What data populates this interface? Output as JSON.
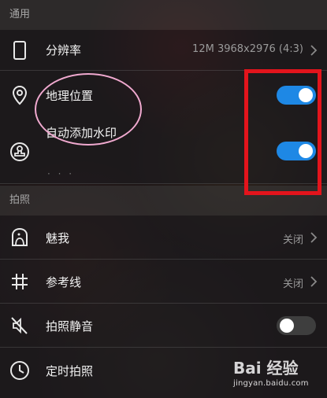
{
  "sections": {
    "general": "通用",
    "capture": "拍照"
  },
  "rows": {
    "resolution": {
      "label": "分辨率",
      "value": "12M 3968x2976 (4:3)"
    },
    "location": {
      "label": "地理位置",
      "toggle": "on"
    },
    "watermark": {
      "label": "自动添加水印",
      "toggle": "on"
    },
    "beauty": {
      "label": "魅我",
      "value": "关闭"
    },
    "gridlines": {
      "label": "参考线",
      "value": "关闭"
    },
    "mute": {
      "label": "拍照静音",
      "toggle": "off"
    },
    "timer": {
      "label": "定时拍照"
    }
  },
  "more_indicator": "· · ·",
  "watermark_overlay": {
    "brand": "Bai 经验",
    "url": "jingyan.baidu.com"
  },
  "colors": {
    "toggle_on": "#1e88e5",
    "annotation_box": "#e3141c",
    "annotation_ellipse": "#f0a9cf"
  }
}
